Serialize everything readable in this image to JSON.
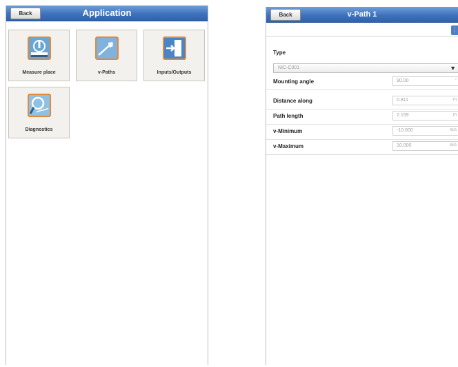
{
  "left_screen": {
    "back_label": "Back",
    "title": "Application",
    "tiles": [
      {
        "label": "Measure place",
        "icon": "measure-place-icon"
      },
      {
        "label": "v-Paths",
        "icon": "v-paths-icon"
      },
      {
        "label": "Inputs/Outputs",
        "icon": "inputs-outputs-icon"
      },
      {
        "label": "Diagnostics",
        "icon": "diagnostics-icon"
      }
    ]
  },
  "right_screen": {
    "back_label": "Back",
    "title": "v-Path 1",
    "type_label": "Type",
    "type_value": "NIC-C001",
    "rows": [
      {
        "label": "Mounting angle",
        "value": "90.00",
        "unit": "°"
      },
      {
        "label": "Distance along",
        "value": "0.811",
        "unit": "m"
      },
      {
        "label": "Path length",
        "value": "2.159",
        "unit": "m"
      },
      {
        "label": "v-Minimum",
        "value": "-10.000",
        "unit": "m/s"
      },
      {
        "label": "v-Maximum",
        "value": "10.000",
        "unit": "m/s"
      }
    ]
  },
  "colors": {
    "titlebar": "#3f72bd",
    "tile_background": "#f3f1ee"
  }
}
